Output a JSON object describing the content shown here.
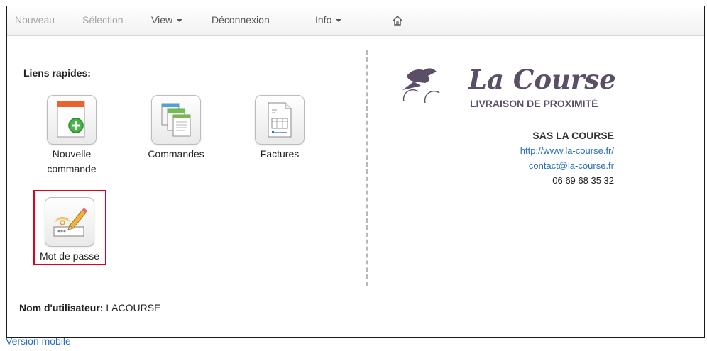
{
  "navbar": {
    "items": [
      {
        "label": "Nouveau",
        "disabled": true
      },
      {
        "label": "Sélection",
        "disabled": true
      },
      {
        "label": "View",
        "dropdown": true
      },
      {
        "label": "Déconnexion"
      },
      {
        "label": "Info",
        "dropdown": true
      }
    ],
    "home_icon": "home-icon"
  },
  "quick_links": {
    "title": "Liens rapides:",
    "tiles": [
      {
        "label": "Nouvelle commande",
        "icon": "new-order-icon"
      },
      {
        "label": "Commandes",
        "icon": "orders-icon"
      },
      {
        "label": "Factures",
        "icon": "invoices-icon"
      },
      {
        "label": "Mot de passe",
        "icon": "password-icon"
      }
    ],
    "highlight_color": "#e0001b"
  },
  "user": {
    "label": "Nom d'utilisateur:",
    "value": "LACOURSE"
  },
  "company": {
    "logo_title": "La Course",
    "logo_subtitle": "LIVRAISON DE PROXIMITÉ",
    "name": "SAS LA COURSE",
    "website": "http://www.la-course.fr/",
    "email": "contact@la-course.fr",
    "phone": "06 69 68 35 32"
  },
  "footer": {
    "mobile_link": "Version mobile"
  },
  "colors": {
    "link": "#2a6eb7",
    "logo": "#5a4f67"
  }
}
